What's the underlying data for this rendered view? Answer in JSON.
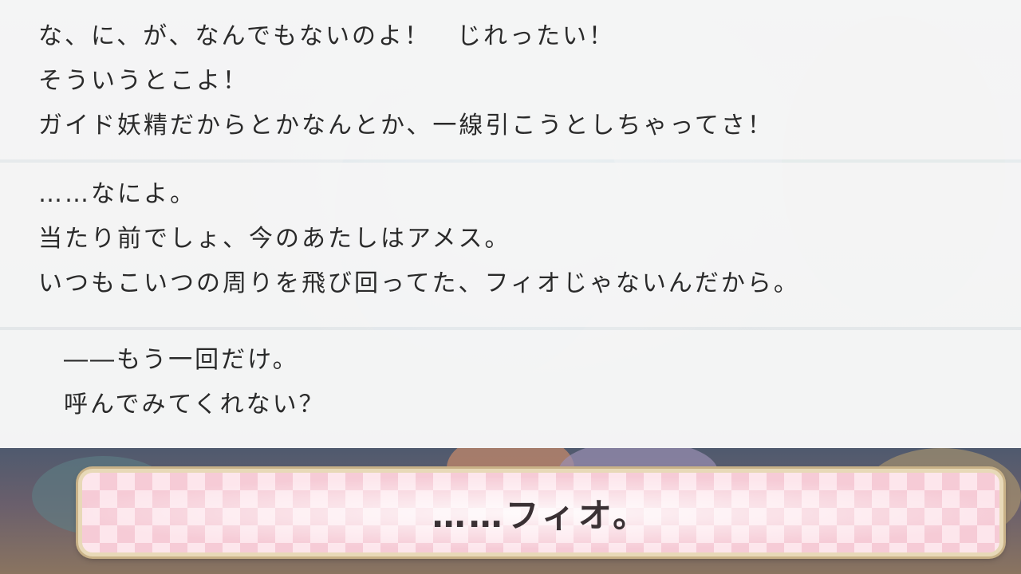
{
  "dialogue": [
    {
      "lines": [
        "な、に、が、なんでもないのよ！　じれったい！",
        "そういうとこよ！",
        "ガイド妖精だからとかなんとか、一線引こうとしちゃってさ！"
      ]
    },
    {
      "lines": [
        "……なによ。",
        "当たり前でしょ、今のあたしはアメス。",
        "いつもこいつの周りを飛び回ってた、フィオじゃないんだから。"
      ]
    },
    {
      "lines": [
        "――もう一回だけ。",
        "呼んでみてくれない？"
      ]
    }
  ],
  "choice": {
    "label": "……フィオ。"
  },
  "colors": {
    "panel_bg": "#f6f6f6",
    "text": "#2a2a2a",
    "choice_pink": "#fde6ec",
    "choice_border": "#e8d9b8"
  }
}
